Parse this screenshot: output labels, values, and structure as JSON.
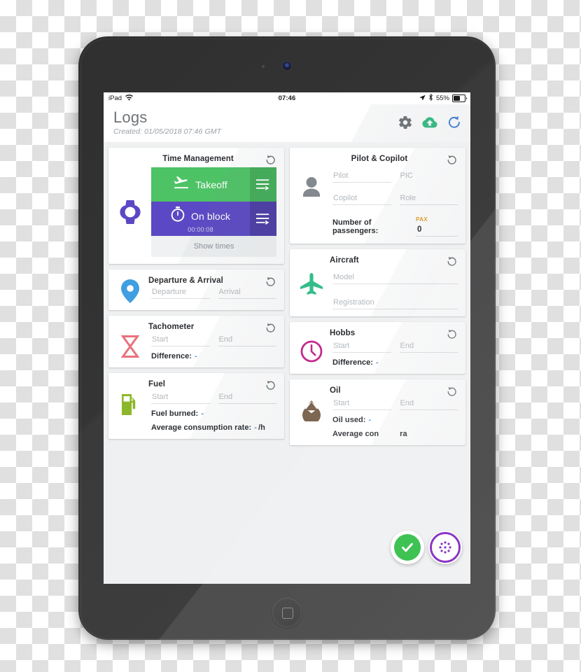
{
  "device": {
    "name": "ipad-tablet",
    "home_button": "home-button",
    "camera": "front-camera"
  },
  "statusbar": {
    "carrier": "iPad",
    "wifi_icon": "wifi-icon",
    "time": "07:46",
    "location_icon": "location-arrow-icon",
    "bluetooth_icon": "bluetooth-icon",
    "battery_percent": "55%",
    "battery_icon": "battery-icon"
  },
  "appbar": {
    "title": "Logs",
    "subtitle": "Created: 01/05/2018 07:46 GMT",
    "actions": [
      {
        "name": "settings-gear-icon",
        "label": "Settings",
        "color": "#6f7478"
      },
      {
        "name": "cloud-upload-icon",
        "label": "Upload",
        "color": "#35bd82"
      },
      {
        "name": "refresh-icon",
        "label": "Refresh",
        "color": "#3f7fd6"
      }
    ]
  },
  "cards": {
    "time_management": {
      "title": "Time Management",
      "icon": "watch-icon",
      "icon_color": "#5b48c4",
      "reset_icon": "reset-icon",
      "takeoff": {
        "label": "Takeoff",
        "icon": "airplane-takeoff-icon",
        "side_icon": "swap-arrows-icon",
        "bg": "#4ec366",
        "side_bg": "#41ad57"
      },
      "on_block": {
        "label": "On block",
        "timer": "00:00:08",
        "icon": "stopwatch-icon",
        "side_icon": "swap-arrows-icon",
        "bg": "#5b48c4",
        "side_bg": "#4b3ba5"
      },
      "show_times_label": "Show times"
    },
    "pilot_copilot": {
      "title": "Pilot & Copilot",
      "icon": "person-icon",
      "icon_color": "#83898e",
      "reset_icon": "reset-icon",
      "fields": [
        {
          "name": "pilot-field",
          "placeholder": "Pilot",
          "value": ""
        },
        {
          "name": "pic-field",
          "placeholder": "PIC",
          "value": ""
        },
        {
          "name": "copilot-field",
          "placeholder": "Copilot",
          "value": ""
        },
        {
          "name": "role-field",
          "placeholder": "Role",
          "value": ""
        }
      ],
      "passengers_label": "Number of passengers:",
      "pax_tag": "PAX",
      "pax_tag_color": "#e5a02c",
      "pax_value": "0"
    },
    "departure_arrival": {
      "title": "Departure & Arrival",
      "icon": "map-pin-icon",
      "icon_color": "#3f9fe0",
      "reset_icon": "reset-icon",
      "fields": [
        {
          "name": "departure-field",
          "placeholder": "Departure",
          "value": ""
        },
        {
          "name": "arrival-field",
          "placeholder": "Arrival",
          "value": ""
        }
      ]
    },
    "aircraft": {
      "title": "Aircraft",
      "icon": "airplane-icon",
      "icon_color": "#35bd8b",
      "reset_icon": "reset-icon",
      "fields": [
        {
          "name": "model-field",
          "placeholder": "Model",
          "value": ""
        },
        {
          "name": "registration-field",
          "placeholder": "Registration",
          "value": ""
        }
      ]
    },
    "tachometer": {
      "title": "Tachometer",
      "icon": "hourglass-icon",
      "icon_color": "#e8727d",
      "reset_icon": "reset-icon",
      "fields": [
        {
          "name": "tach-start-field",
          "placeholder": "Start",
          "value": ""
        },
        {
          "name": "tach-end-field",
          "placeholder": "End",
          "value": ""
        }
      ],
      "difference_label": "Difference:",
      "difference_value": "-"
    },
    "hobbs": {
      "title": "Hobbs",
      "icon": "clock-icon",
      "icon_color": "#c42b8e",
      "reset_icon": "reset-icon",
      "fields": [
        {
          "name": "hobbs-start-field",
          "placeholder": "Start",
          "value": ""
        },
        {
          "name": "hobbs-end-field",
          "placeholder": "End",
          "value": ""
        }
      ],
      "difference_label": "Difference:",
      "difference_value": "-"
    },
    "fuel": {
      "title": "Fuel",
      "icon": "fuel-pump-icon",
      "icon_color": "#8db72a",
      "reset_icon": "reset-icon",
      "fields": [
        {
          "name": "fuel-start-field",
          "placeholder": "Start",
          "value": ""
        },
        {
          "name": "fuel-end-field",
          "placeholder": "End",
          "value": ""
        }
      ],
      "burned_label": "Fuel burned:",
      "burned_value": "-",
      "rate_label": "Average consumption rate:",
      "rate_value": "-",
      "rate_unit": "/h"
    },
    "oil": {
      "title": "Oil",
      "icon": "oil-drop-icon",
      "icon_color": "#7d6652",
      "reset_icon": "reset-icon",
      "fields": [
        {
          "name": "oil-start-field",
          "placeholder": "Start",
          "value": ""
        },
        {
          "name": "oil-end-field",
          "placeholder": "End",
          "value": ""
        }
      ],
      "used_label": "Oil used:",
      "used_value": "-",
      "rate_label": "Average con",
      "rate_value": "ra"
    }
  },
  "fabs": [
    {
      "name": "confirm-fab",
      "icon": "check-icon",
      "color": "#3fc254"
    },
    {
      "name": "more-actions-fab",
      "icon": "dots-circle-icon",
      "color": "#8b35c4"
    }
  ]
}
